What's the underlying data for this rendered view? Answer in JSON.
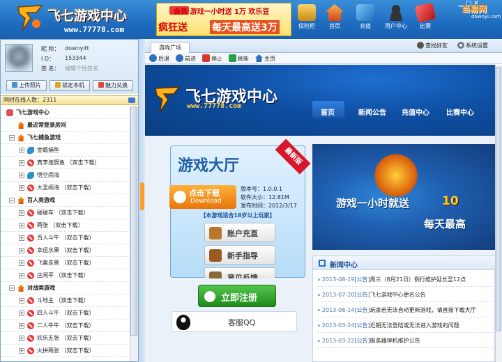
{
  "app": {
    "logo_title": "飞七游戏中心",
    "logo_url": "www.77778.com"
  },
  "banner": {
    "line1": "会员 游戏一小时送 1万 欢乐豆",
    "line2a": "疯狂送",
    "line2b": "每天最高送3万"
  },
  "topnav": [
    {
      "label": "保险柜",
      "icon": "safe-icon",
      "color": "#d8a22c"
    },
    {
      "label": "首页",
      "icon": "home-icon",
      "color": "#e8632a"
    },
    {
      "label": "充值",
      "icon": "recharge-icon",
      "color": "#3e98d9"
    },
    {
      "label": "用户中心",
      "icon": "user-icon",
      "color": "#555"
    },
    {
      "label": "比赛",
      "icon": "match-icon",
      "color": "#d83232"
    }
  ],
  "watermark": {
    "main": "当易网",
    "sub": "downyi.com"
  },
  "profile": {
    "nickname_label": "昵  称：",
    "nickname": "downyitt",
    "id_label": "I   D：",
    "id": "153344",
    "sign_label": "签  名：",
    "sign_placeholder": "编辑个性签名",
    "buttons": [
      "上传照片",
      "锁定本机",
      "魅力兑换"
    ]
  },
  "online": {
    "text": "同时在线人数：2311"
  },
  "tree": [
    {
      "type": "root",
      "label": "飞七游戏中心",
      "icon": "game-center-icon"
    },
    {
      "type": "item0",
      "label": "最近常登录房间",
      "icon": "house-icon"
    },
    {
      "type": "group",
      "label": "飞七捕鱼游戏",
      "icon": "house-icon"
    },
    {
      "type": "child",
      "label": "金蟾捕鱼",
      "icon": "fish-icon"
    },
    {
      "type": "child",
      "label": "真李逵劈鱼 （双击下载）",
      "icon": "no-icon"
    },
    {
      "type": "child",
      "label": "悟空闹海",
      "icon": "fish-icon"
    },
    {
      "type": "child",
      "label": "大圣闹海 （双击下载）",
      "icon": "no-icon"
    },
    {
      "type": "group",
      "label": "百人类游戏",
      "icon": "house-icon"
    },
    {
      "type": "child",
      "label": "碰碰车 （双击下载）",
      "icon": "no-icon"
    },
    {
      "type": "child",
      "label": "两张 （双击下载）",
      "icon": "no-icon"
    },
    {
      "type": "child",
      "label": "百人斗牛 （双击下载）",
      "icon": "no-icon"
    },
    {
      "type": "child",
      "label": "幸运水果 （双击下载）",
      "icon": "no-icon"
    },
    {
      "type": "child",
      "label": "飞禽走兽 （双击下载）",
      "icon": "no-icon"
    },
    {
      "type": "child",
      "label": "庄闲平 （双击下载）",
      "icon": "no-icon"
    },
    {
      "type": "group",
      "label": "对战类游戏",
      "icon": "house-icon"
    },
    {
      "type": "child",
      "label": "斗地主 （双击下载）",
      "icon": "no-icon"
    },
    {
      "type": "child",
      "label": "四人斗牛 （双击下载）",
      "icon": "no-icon"
    },
    {
      "type": "child",
      "label": "二人牛牛 （双击下载）",
      "icon": "no-icon"
    },
    {
      "type": "child",
      "label": "欢乐五张 （双击下载）",
      "icon": "no-icon"
    },
    {
      "type": "child",
      "label": "火拼两张 （双击下载）",
      "icon": "no-icon"
    }
  ],
  "tabs": {
    "main": "游戏广场",
    "find_friend": "查找好友",
    "settings": "系统设置"
  },
  "toolbar": {
    "back": "后退",
    "forward": "前进",
    "stop": "停止",
    "refresh": "刷新",
    "home": "主页"
  },
  "site": {
    "logo": "飞七游戏中心",
    "logo_url": "www.77778.com",
    "nav": [
      "首页",
      "新闻公告",
      "充值中心",
      "比赛中心"
    ],
    "lobby_title": "游戏大厅",
    "ribbon": "最新版",
    "download_t1": "点击下载",
    "download_t2": "Download",
    "version": "版本号：1.0.0.1",
    "size": "软件大小：12.81M",
    "date": "发布时间：2012/3/17",
    "age_note": "【本游戏适合18岁以上玩家】",
    "side_buttons": [
      "账户充直",
      "新手指导",
      "意见反馈"
    ],
    "register": "立即注册",
    "qq": "客服QQ",
    "promo1": "游戏一小时就送",
    "promo2": "10",
    "promo3": "每天最高",
    "news_title": "新闻中心",
    "news": [
      {
        "date": "2013-08-19",
        "tag": "[公告]",
        "text": "周三（8月21日）例行维护延长至12点"
      },
      {
        "date": "2013-07-20",
        "tag": "[公告]",
        "text": "飞七游戏中心更名公告"
      },
      {
        "date": "2013-06-14",
        "tag": "[公告]",
        "text": "玩家若无法自动更新游戏，请直接下载大厅"
      },
      {
        "date": "2013-03-24",
        "tag": "[公告]",
        "text": "近期无法登陆或无法进入游戏的问题"
      },
      {
        "date": "2013-03-22",
        "tag": "[公告]",
        "text": "服务器停机维护公告"
      }
    ]
  },
  "colors": {
    "header": "#1e6cc0",
    "accent": "#ff9d2b",
    "site_bg": "#0c4a8f"
  }
}
